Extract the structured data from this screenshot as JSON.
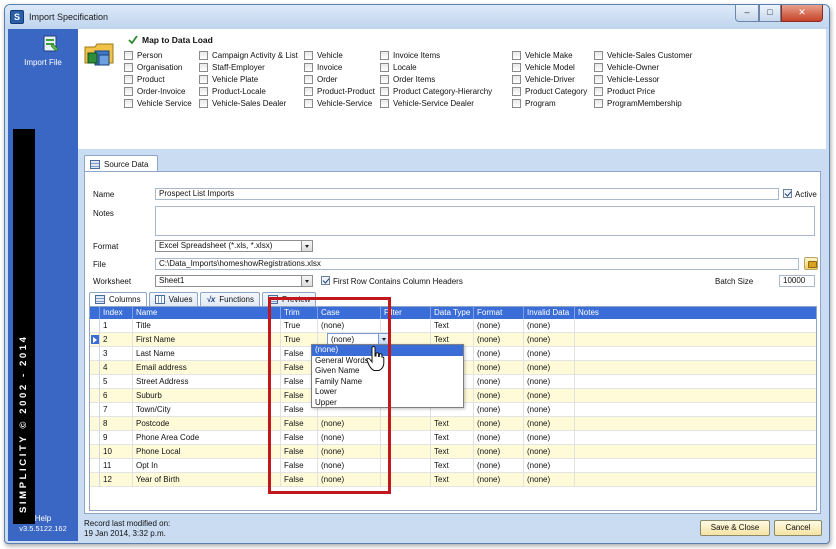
{
  "window": {
    "title": "Import Specification",
    "controls": {
      "minimize": "–",
      "maximize": "□",
      "close": "✕"
    }
  },
  "rail": {
    "import_label": "Import File",
    "brand": "SIMPLICITY © 2002 - 2014",
    "help_label": "Help",
    "version": "v3.5.5122.162"
  },
  "map": {
    "title": "Map to Data Load",
    "columns": [
      [
        "Person",
        "Organisation",
        "Product",
        "Order-Invoice",
        "Vehicle Service"
      ],
      [
        "Campaign Activity & List",
        "Staff-Employer",
        "Vehicle Plate",
        "Product-Locale",
        "Vehicle-Sales Dealer"
      ],
      [
        "Vehicle",
        "Invoice",
        "Order",
        "Product-Product",
        "Vehicle-Service"
      ],
      [
        "Invoice Items",
        "Locale",
        "Order Items",
        "Product Category-Hierarchy",
        "Vehicle-Service Dealer"
      ],
      [
        "Vehicle Make",
        "Vehicle Model",
        "Vehicle-Driver",
        "Product Category",
        "Program"
      ],
      [
        "Vehicle-Sales Customer",
        "Vehicle-Owner",
        "Vehicle-Lessor",
        "Product Price",
        "ProgramMembership"
      ]
    ]
  },
  "source_tab": "Source Data",
  "form": {
    "name_label": "Name",
    "name_value": "Prospect List Imports",
    "active_label": "Active",
    "notes_label": "Notes",
    "notes_value": "",
    "format_label": "Format",
    "format_value": "Excel Spreadsheet (*.xls, *.xlsx)",
    "file_label": "File",
    "file_value": "C:\\Data_Imports\\homeshowRegistrations.xlsx",
    "worksheet_label": "Worksheet",
    "worksheet_value": "Sheet1",
    "first_row_label": "First Row Contains Column Headers",
    "batch_label": "Batch Size",
    "batch_value": "10000"
  },
  "subtabs": [
    "Columns",
    "Values",
    "Functions",
    "Preview"
  ],
  "grid": {
    "headers": [
      "Index",
      "Name",
      "Trim",
      "Case",
      "Filter",
      "Data Type",
      "Format",
      "Invalid Data",
      "Notes"
    ],
    "rows": [
      [
        "1",
        "Title",
        "True",
        "(none)",
        "",
        "Text",
        "(none)",
        "(none)"
      ],
      [
        "2",
        "First Name",
        "True",
        "(none)",
        "",
        "Text",
        "(none)",
        "(none)"
      ],
      [
        "3",
        "Last Name",
        "False",
        "",
        "",
        "",
        "(none)",
        "(none)"
      ],
      [
        "4",
        "Email address",
        "False",
        "",
        "",
        "",
        "(none)",
        "(none)"
      ],
      [
        "5",
        "Street Address",
        "False",
        "",
        "",
        "",
        "(none)",
        "(none)"
      ],
      [
        "6",
        "Suburb",
        "False",
        "",
        "",
        "",
        "(none)",
        "(none)"
      ],
      [
        "7",
        "Town/City",
        "False",
        "",
        "",
        "",
        "(none)",
        "(none)"
      ],
      [
        "8",
        "Postcode",
        "False",
        "(none)",
        "",
        "Text",
        "(none)",
        "(none)"
      ],
      [
        "9",
        "Phone Area Code",
        "False",
        "(none)",
        "",
        "Text",
        "(none)",
        "(none)"
      ],
      [
        "10",
        "Phone Local",
        "False",
        "(none)",
        "",
        "Text",
        "(none)",
        "(none)"
      ],
      [
        "11",
        "Opt In",
        "False",
        "(none)",
        "",
        "Text",
        "(none)",
        "(none)"
      ],
      [
        "12",
        "Year of Birth",
        "False",
        "(none)",
        "",
        "Text",
        "(none)",
        "(none)"
      ]
    ],
    "case_select_value": "(none)",
    "case_options": [
      "(none)",
      "General Words",
      "Given Name",
      "Family Name",
      "Lower",
      "Upper"
    ]
  },
  "footer": {
    "record_label": "Record last modified on:",
    "record_date": "19 Jan 2014, 3:32 p.m.",
    "save_close": "Save & Close",
    "cancel": "Cancel"
  },
  "colors": {
    "rail": "#3a67c4",
    "grid_header": "#3a6dd8",
    "highlight": "#c2181d",
    "row_alt": "#fffbd9"
  }
}
